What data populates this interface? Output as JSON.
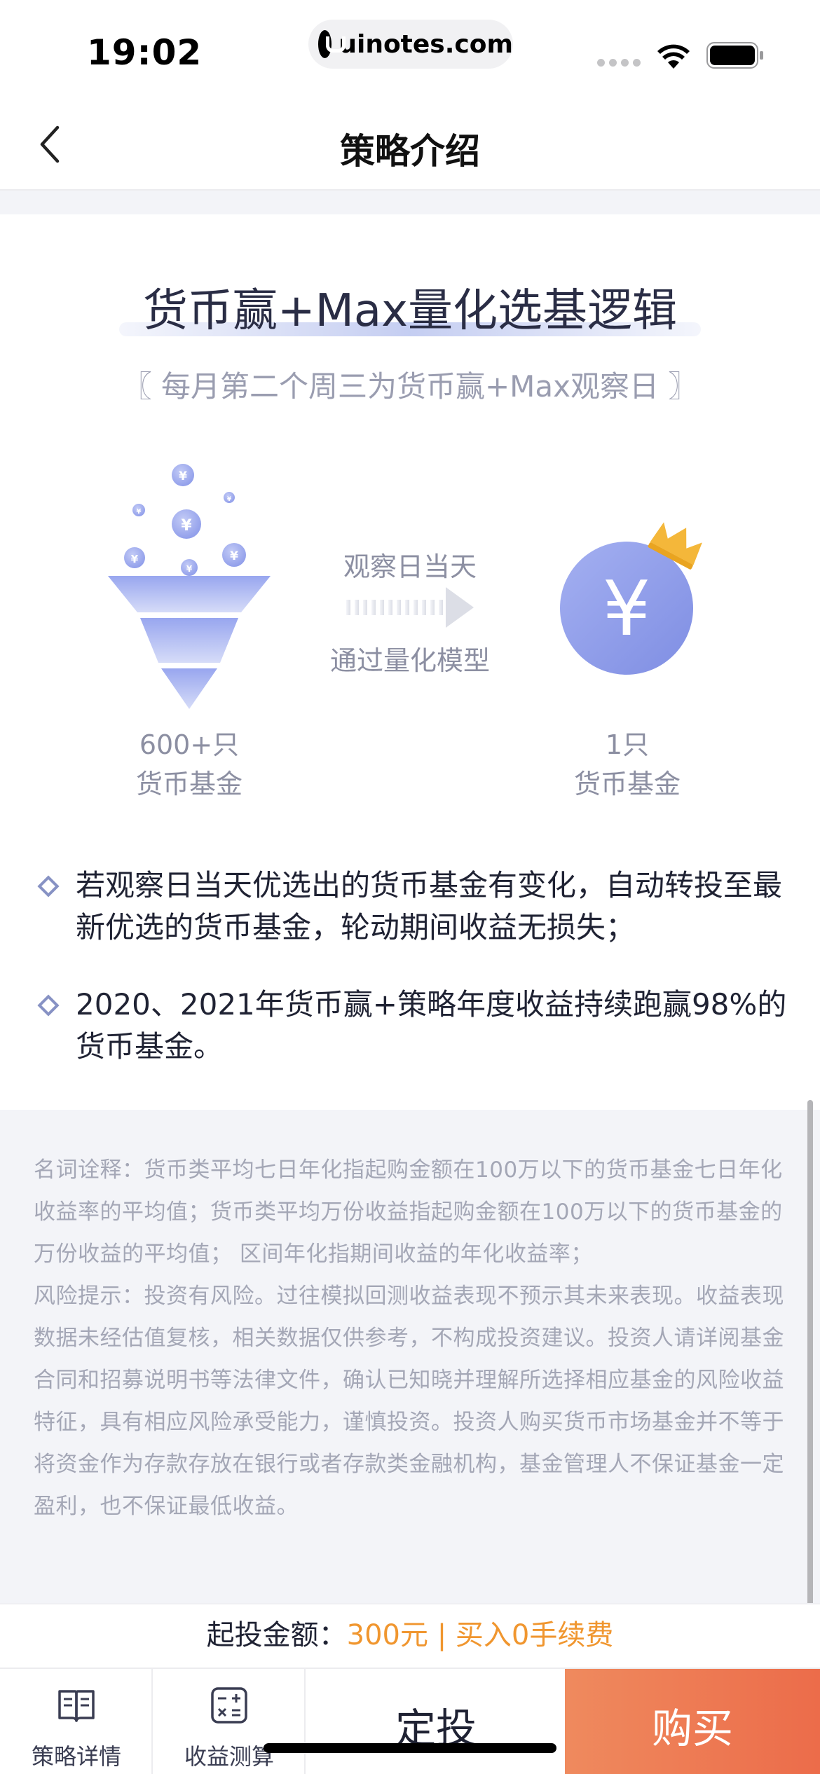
{
  "status_bar": {
    "time": "19:02",
    "url": "uinotes.com",
    "icons": [
      "signal-icon",
      "wifi-icon",
      "battery-icon"
    ]
  },
  "nav": {
    "title": "策略介绍",
    "back_icon": "chevron-left-icon"
  },
  "intro": {
    "title": "货币赢+Max量化选基逻辑",
    "observe_day": "〖 每月第二个周三为货币赢+Max观察日 〗",
    "arrow_top": "观察日当天",
    "arrow_bottom": "通过量化模型",
    "left_count": "600+只",
    "left_label": "货币基金",
    "right_count": "1只",
    "right_label": "货币基金",
    "coin_symbol": "¥"
  },
  "bullets": [
    {
      "text": "若观察日当天优选出的货币基金有变化，自动转投至最新优选的货币基金，轮动期间收益无损失；"
    },
    {
      "text": "2020、2021年货币赢+策略年度收益持续跑赢98%的货币基金。"
    }
  ],
  "disclaimer": {
    "terms": "名词诠释：货币类平均七日年化指起购金额在100万以下的货币基金七日年化收益率的平均值；货币类平均万份收益指起购金额在100万以下的货币基金的万份收益的平均值； 区间年化指期间收益的年化收益率；",
    "risk": "风险提示：投资有风险。过往模拟回测收益表现不预示其未来表现。收益表现数据未经估值复核，相关数据仅供参考，不构成投资建议。投资人请详阅基金合同和招募说明书等法律文件，确认已知晓并理解所选择相应基金的风险收益特征，具有相应风险承受能力，谨慎投资。投资人购买货币市场基金并不等于将资金作为存款存放在银行或者存款类金融机构，基金管理人不保证基金一定盈利，也不保证最低收益。"
  },
  "start_amount": {
    "label": "起投金额：",
    "value": "300元 | 买入0手续费"
  },
  "tabs": {
    "details_label": "策略详情",
    "calc_label": "收益测算",
    "dingtou_label": "定投",
    "buy_label": "购买"
  },
  "colors": {
    "accent_orange": "#f0962f",
    "buy_gradient_start": "#ef8a5e",
    "buy_gradient_end": "#ec6c4a",
    "coin_blue": "#8f9de8",
    "crown_gold": "#f4b73a"
  }
}
